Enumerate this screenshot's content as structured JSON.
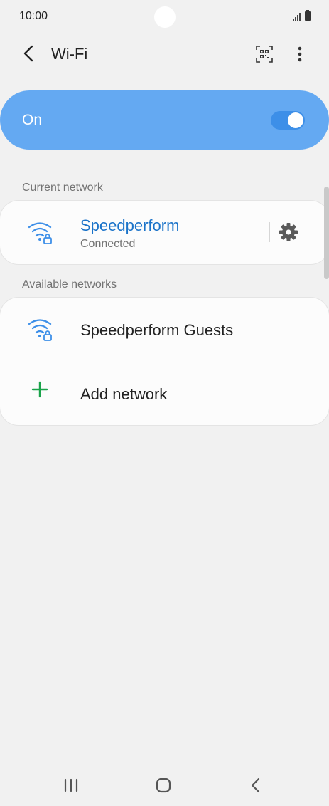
{
  "status_bar": {
    "time": "10:00"
  },
  "header": {
    "title": "Wi-Fi",
    "icons": [
      "back-arrow-icon",
      "qr-code-icon",
      "more-options-icon"
    ]
  },
  "wifi_toggle": {
    "label": "On",
    "enabled": true,
    "accent_color": "#64a9f2"
  },
  "current_network": {
    "section_title": "Current network",
    "name": "Speedperform",
    "status": "Connected",
    "name_color": "#1b73c9"
  },
  "available_networks": {
    "section_title": "Available networks",
    "items": [
      {
        "name": "Speedperform Guests",
        "icon": "wifi-locked-icon"
      }
    ],
    "add_label": "Add network",
    "add_color": "#1aa34a"
  },
  "nav_bar": {
    "icons": [
      "recent-apps-icon",
      "home-icon",
      "back-icon"
    ]
  }
}
